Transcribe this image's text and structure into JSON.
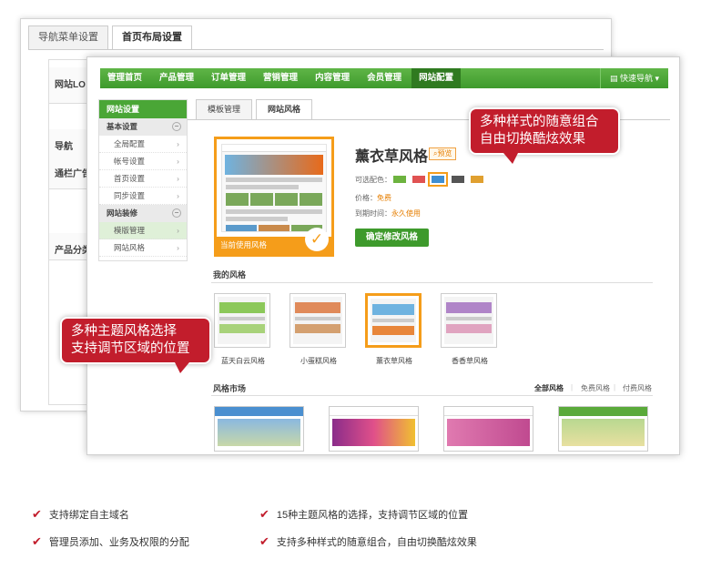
{
  "back_window": {
    "tabs": [
      "导航菜单设置",
      "首页布局设置"
    ],
    "rows": [
      "网站LO",
      "导航",
      "通栏广告",
      "产品分类"
    ]
  },
  "nav": {
    "items": [
      "管理首页",
      "产品管理",
      "订单管理",
      "营销管理",
      "内容管理",
      "会员管理",
      "网站配置"
    ],
    "quick_nav": "快速导航"
  },
  "sidebar": {
    "title": "网站设置",
    "groups": [
      {
        "label": "基本设置",
        "items": [
          "全局配置",
          "帐号设置",
          "首页设置",
          "同步设置"
        ]
      },
      {
        "label": "网站装修",
        "items": [
          "模版管理",
          "网站风格"
        ]
      }
    ]
  },
  "tabs": [
    "模板管理",
    "网站风格"
  ],
  "current_theme": {
    "name": "薰衣草风格",
    "preview": "预览",
    "label": "当前使用风格",
    "colors_label": "可选配色：",
    "swatch_colors": [
      "#6db33f",
      "#e05252",
      "#3f8fd2",
      "#555555",
      "#e0a030"
    ],
    "price_label": "价格：",
    "price": "免费",
    "expire_label": "到期时间：",
    "expire": "永久使用",
    "confirm": "确定修改风格"
  },
  "my_styles": {
    "title": "我的风格",
    "items": [
      "蓝天白云风格",
      "小蛋糕风格",
      "薰衣草风格",
      "香香草风格"
    ]
  },
  "market": {
    "title": "风格市场",
    "filters": [
      "全部风格",
      "免费风格",
      "付费风格"
    ]
  },
  "callouts": {
    "right": [
      "多种样式的随意组合",
      "自由切换酷炫效果"
    ],
    "left": [
      "多种主题风格选择",
      "支持调节区域的位置"
    ]
  },
  "features": [
    "支持绑定自主域名",
    "15种主题风格的选择，支持调节区域的位置",
    "管理员添加、业务及权限的分配",
    "支持多种样式的随意组合，自由切换酷炫效果"
  ]
}
